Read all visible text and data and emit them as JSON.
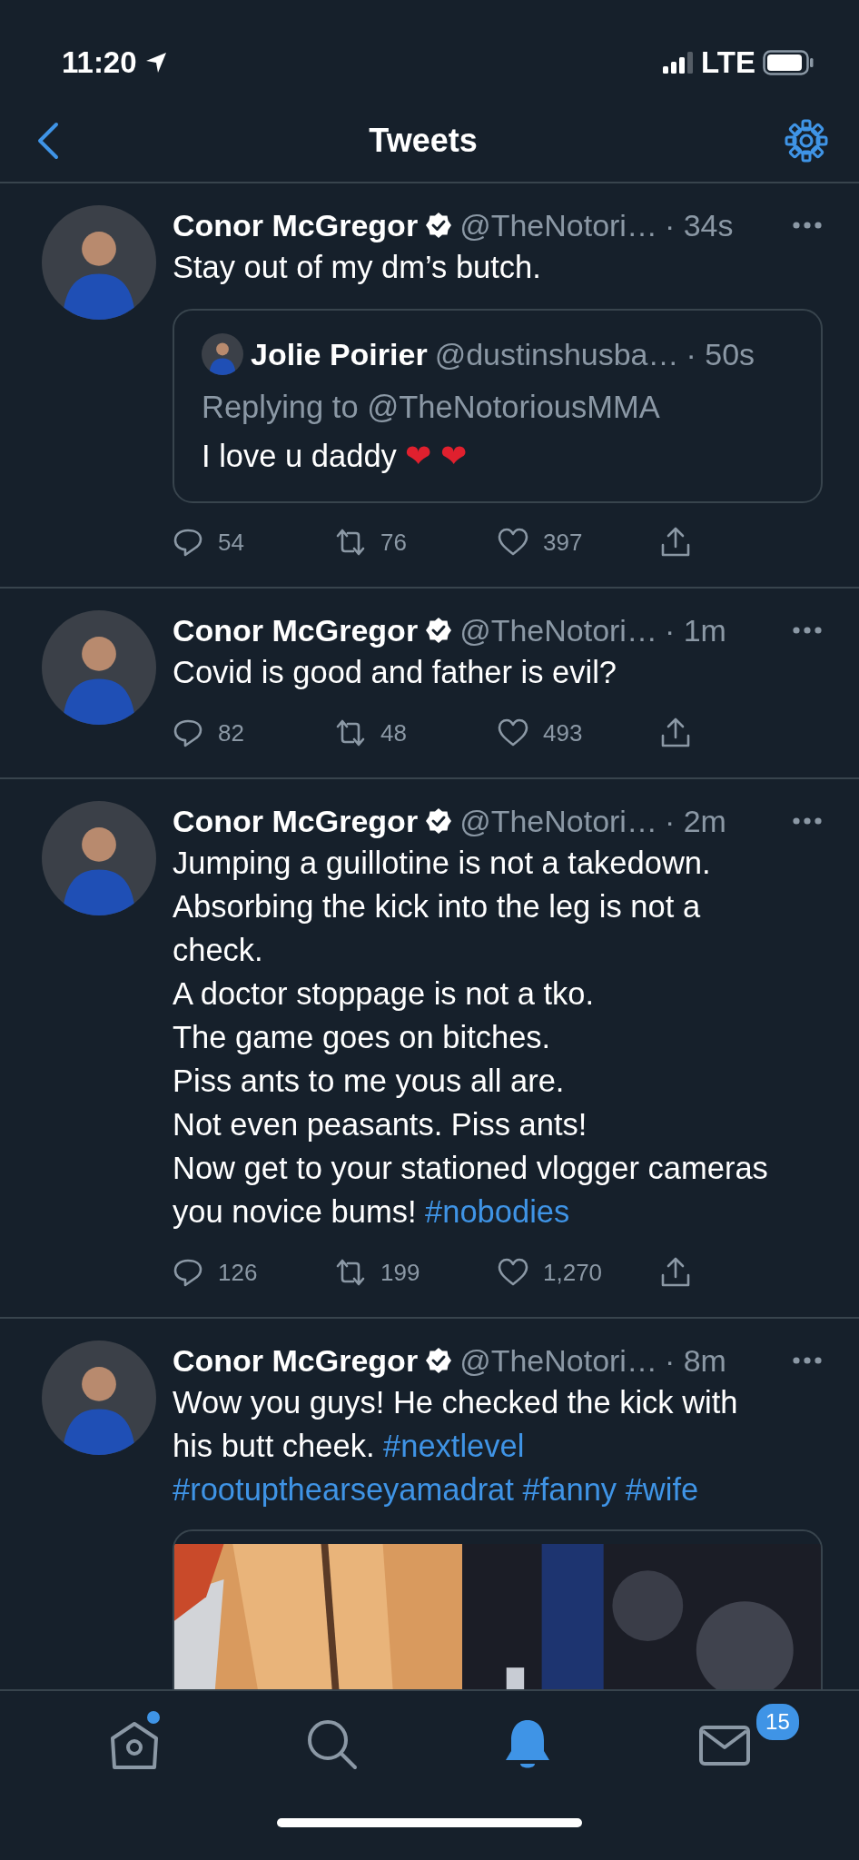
{
  "status_bar": {
    "time": "11:20",
    "network": "LTE"
  },
  "header": {
    "title": "Tweets"
  },
  "tweets": [
    {
      "name": "Conor McGregor",
      "handle": "@TheNotori…",
      "time": "· 34s",
      "body": [
        {
          "kind": "text",
          "text": "Stay out of my dm’s butch."
        }
      ],
      "quote": {
        "name": "Jolie Poirier",
        "handle": "@dustinshusba…",
        "time": "· 50s",
        "replying_to": "Replying to @TheNotoriousMMA",
        "body": [
          {
            "kind": "text",
            "text": "I love u daddy "
          },
          {
            "kind": "emoji",
            "text": "❤"
          },
          {
            "kind": "emoji",
            "text": "❤"
          }
        ]
      },
      "replies": "54",
      "retweets": "76",
      "likes": "397"
    },
    {
      "name": "Conor McGregor",
      "handle": "@TheNotori…",
      "time": "· 1m",
      "body": [
        {
          "kind": "text",
          "text": "Covid is good and father is evil?"
        }
      ],
      "replies": "82",
      "retweets": "48",
      "likes": "493"
    },
    {
      "name": "Conor McGregor",
      "handle": "@TheNotori…",
      "time": "· 2m",
      "body": [
        {
          "kind": "text",
          "text": "Jumping a guillotine is not a takedown.\nAbsorbing the kick into the leg is not a check.\nA doctor stoppage is not a tko.\nThe game goes on bitches.\nPiss ants to me yous all are.\nNot even peasants. Piss ants!\nNow get to your stationed vlogger cameras you novice bums! "
        },
        {
          "kind": "hashtag",
          "text": "#nobodies"
        }
      ],
      "replies": "126",
      "retweets": "199",
      "likes": "1,270"
    },
    {
      "name": "Conor McGregor",
      "handle": "@TheNotori…",
      "time": "· 8m",
      "body": [
        {
          "kind": "text",
          "text": "Wow you guys! He checked the kick with his butt cheek. "
        },
        {
          "kind": "hashtag",
          "text": "#nextlevel"
        },
        {
          "kind": "hashtag",
          "text": "#rootupthearseyamadrat"
        },
        {
          "kind": "hashtag",
          "text": "#fanny"
        },
        {
          "kind": "hashtag",
          "text": "#wife"
        }
      ]
    }
  ],
  "tab_bar": [
    {
      "kind": "home",
      "selected": false,
      "unread": true
    },
    {
      "kind": "search",
      "selected": false,
      "unread": false
    },
    {
      "kind": "notifications",
      "selected": true,
      "unread": false
    },
    {
      "kind": "messages",
      "selected": false,
      "unread": false,
      "badge": "15"
    }
  ]
}
